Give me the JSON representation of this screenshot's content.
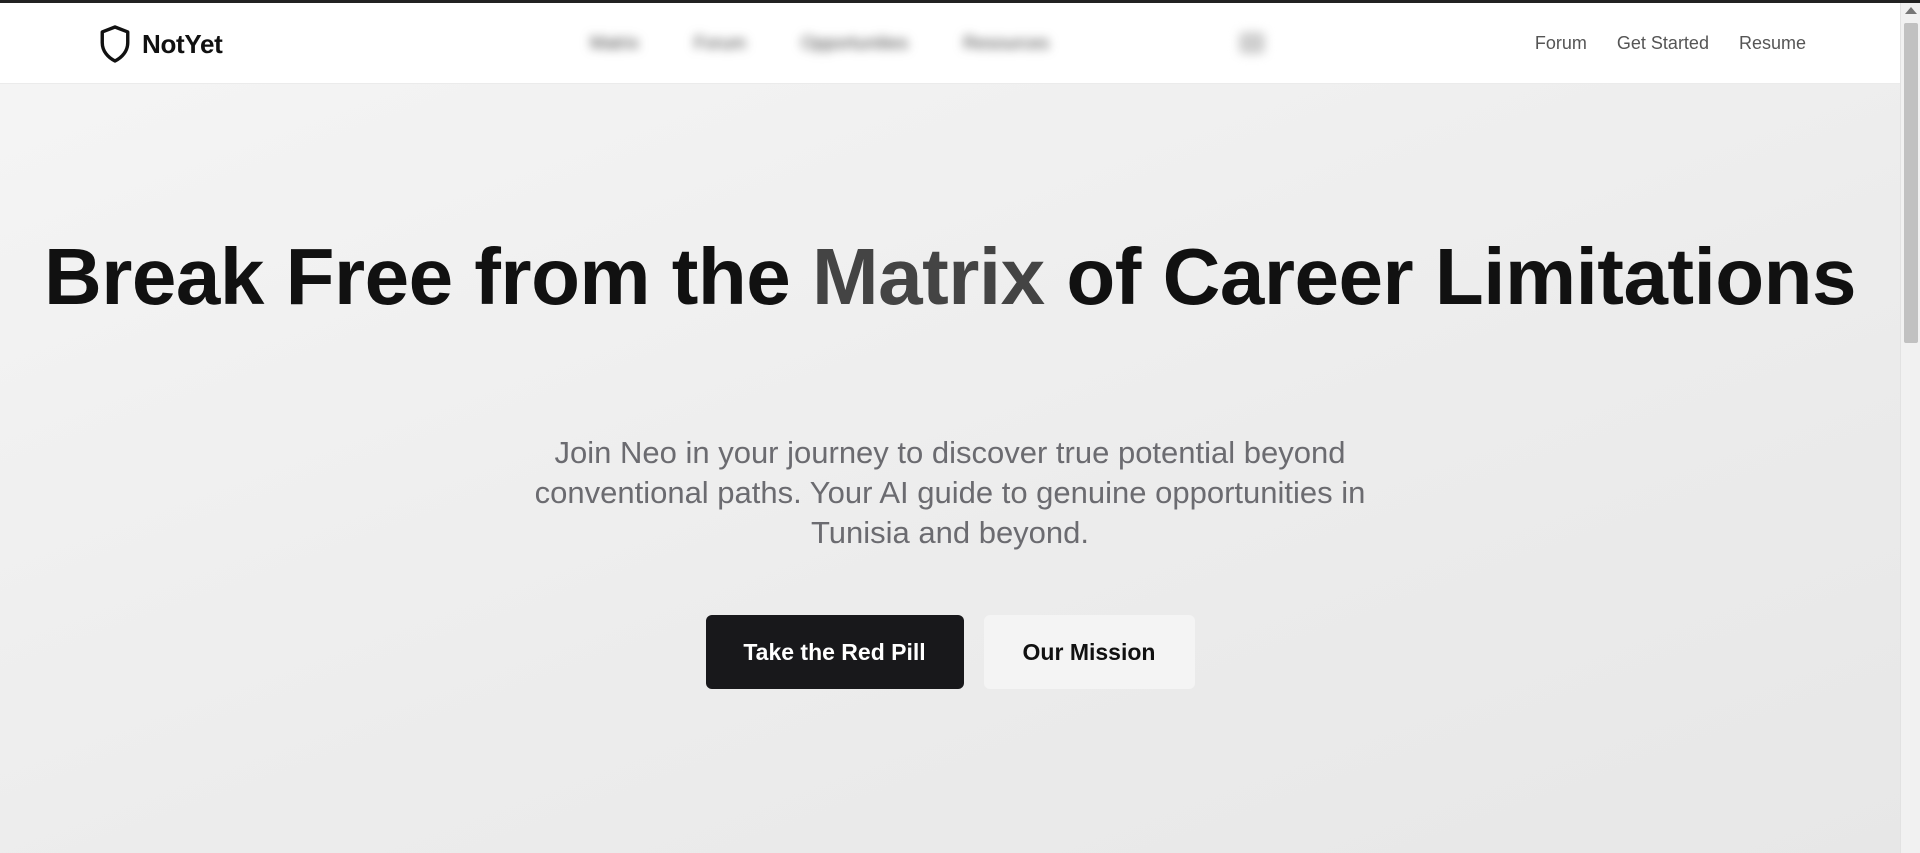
{
  "header": {
    "brand": "NotYet",
    "center_nav_blurred": [
      "Matrix",
      "Forum",
      "Opportunities",
      "Resources"
    ],
    "right_nav": [
      "Forum",
      "Get Started",
      "Resume"
    ]
  },
  "hero": {
    "title_part1": "Break Free from the ",
    "title_accent": "Matrix",
    "title_part2": " of Career Limitations",
    "subtitle": "Join Neo in your journey to discover true potential beyond conventional paths. Your AI guide to genuine opportunities in Tunisia and beyond.",
    "primary_cta": "Take the Red Pill",
    "secondary_cta": "Our Mission"
  },
  "colors": {
    "primary_button": "#18181b",
    "accent_text": "#444444",
    "subtitle_text": "#6b6b70"
  },
  "icons": {
    "logo": "shield-icon",
    "scroll_up": "arrow-up-icon"
  }
}
